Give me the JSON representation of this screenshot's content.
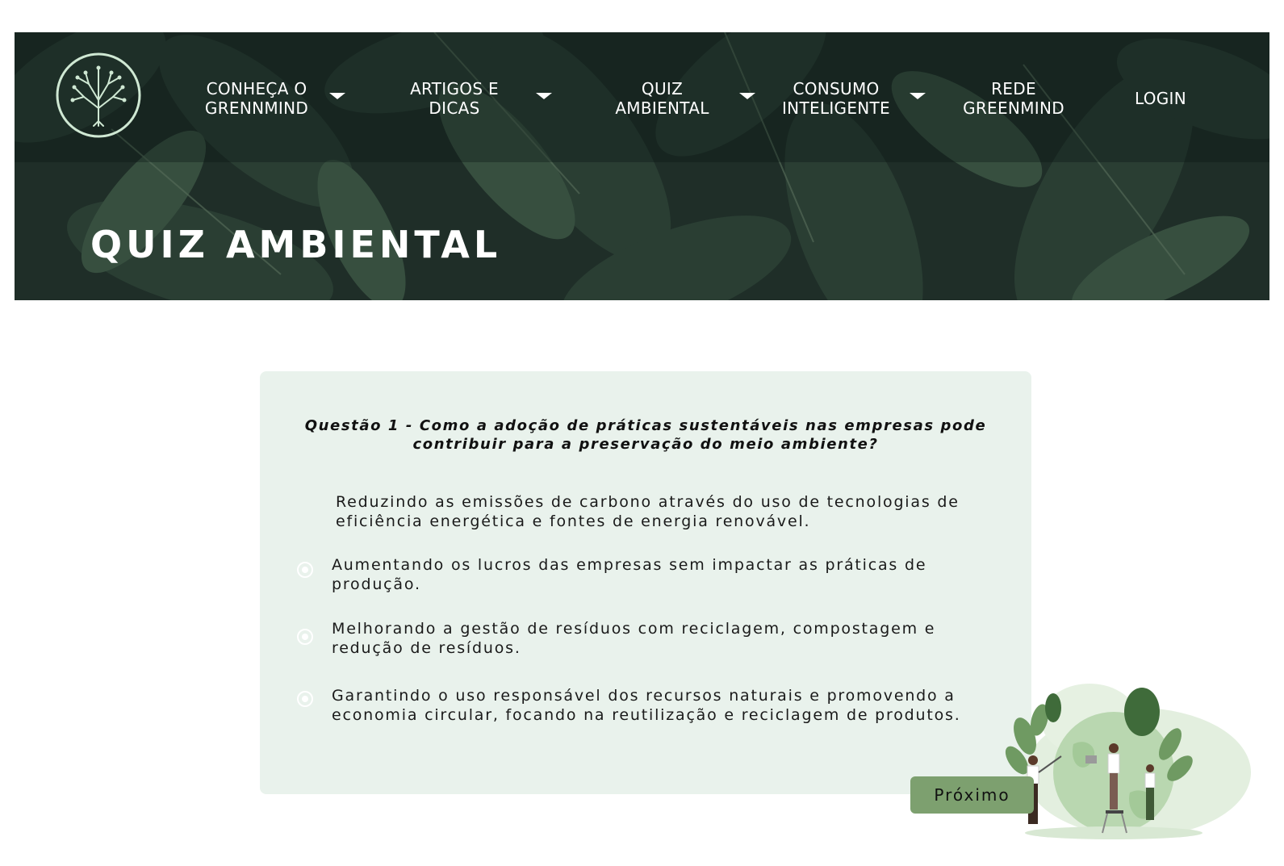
{
  "header": {
    "nav": [
      {
        "lines": [
          "CONHEÇA O",
          "GRENNMIND"
        ],
        "has_dropdown": true
      },
      {
        "lines": [
          "ARTIGOS E",
          "DICAS"
        ],
        "has_dropdown": true
      },
      {
        "lines": [
          "QUIZ",
          "AMBIENTAL"
        ],
        "has_dropdown": true
      },
      {
        "lines": [
          "CONSUMO",
          "INTELIGENTE"
        ],
        "has_dropdown": true
      },
      {
        "lines": [
          "REDE",
          "GREENMIND"
        ],
        "has_dropdown": false
      },
      {
        "lines": [
          "LOGIN"
        ],
        "has_dropdown": false
      }
    ],
    "logo_icon": "tree-logo-icon",
    "page_title": "QUIZ AMBIENTAL"
  },
  "quiz": {
    "question": "Questão 1 - Como a adoção de práticas sustentáveis nas empresas pode contribuir para a preservação do meio ambiente?",
    "question_lines": [
      "Questão 1 - Como a adoção de práticas sustentáveis nas empresas pode",
      "contribuir para a preservação do meio ambiente?"
    ],
    "options": [
      {
        "lines": [
          "Reduzindo as emissões de carbono através do uso de tecnologias de",
          "eficiência energética e fontes de energia renovável."
        ],
        "has_radio": false
      },
      {
        "lines": [
          "Aumentando os lucros das empresas sem impactar as práticas de",
          "produção."
        ],
        "has_radio": true
      },
      {
        "lines": [
          "Melhorando a gestão de resíduos com reciclagem, compostagem e",
          "redução de resíduos."
        ],
        "has_radio": true
      },
      {
        "lines": [
          "Garantindo o uso responsável dos recursos naturais e promovendo a",
          "economia circular, focando na reutilização e reciclagem de produtos."
        ],
        "has_radio": true
      }
    ],
    "next_label": "Próximo"
  },
  "colors": {
    "card_background": "#e9f2ec",
    "button": "#7da06f",
    "nav_text": "#ffffff"
  }
}
